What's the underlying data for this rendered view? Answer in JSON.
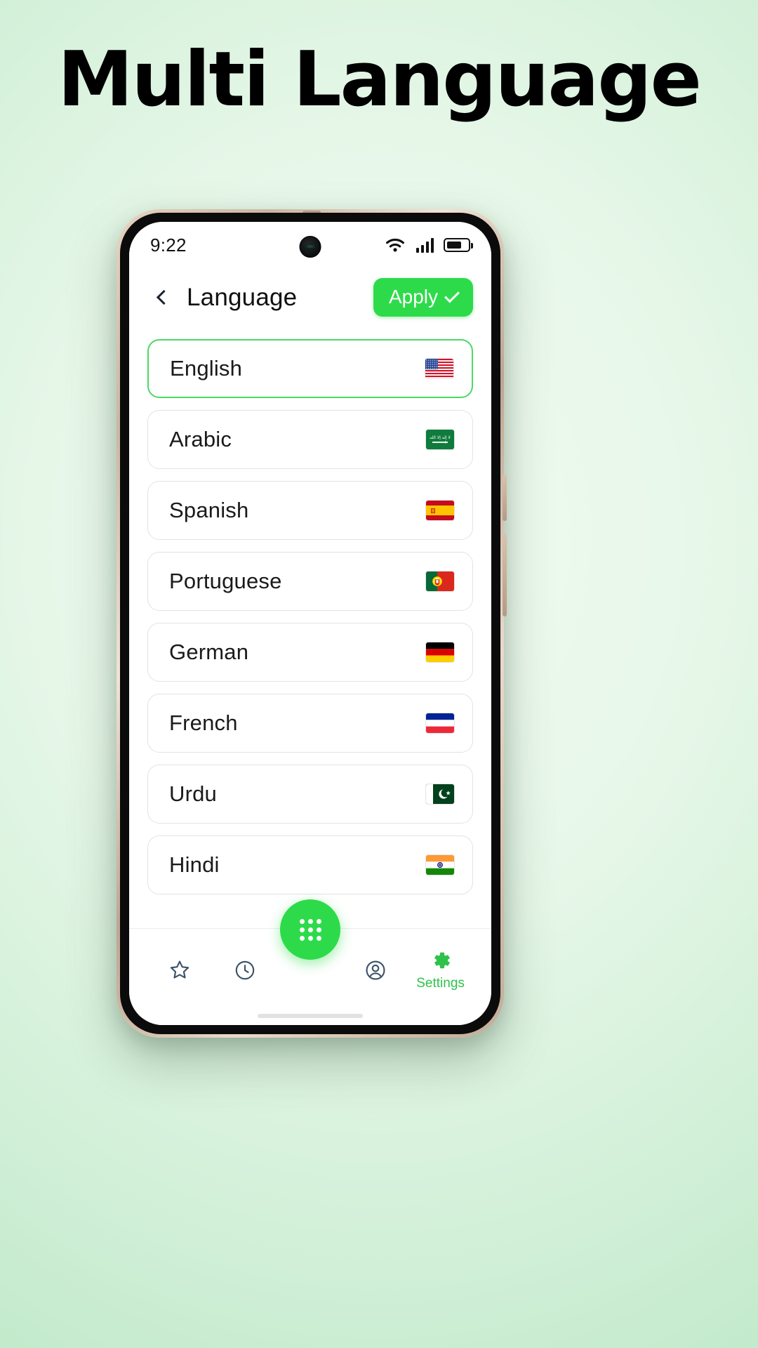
{
  "hero": {
    "title": "Multi Language"
  },
  "theme": {
    "accent": "#2ddb4a",
    "accent_border": "#4cd964",
    "background_start": "#f2fbf3",
    "background_end": "#b8e6c3",
    "text": "#111111"
  },
  "status_bar": {
    "time": "9:22",
    "icons": [
      "wifi-icon",
      "signal-bars-icon",
      "battery-icon"
    ]
  },
  "header": {
    "back_icon": "chevron-left-icon",
    "title": "Language",
    "apply_label": "Apply",
    "apply_icon": "check-icon"
  },
  "languages": [
    {
      "name": "English",
      "flag": "us",
      "selected": true
    },
    {
      "name": "Arabic",
      "flag": "sa",
      "selected": false
    },
    {
      "name": "Spanish",
      "flag": "es",
      "selected": false
    },
    {
      "name": "Portuguese",
      "flag": "pt",
      "selected": false
    },
    {
      "name": "German",
      "flag": "de",
      "selected": false
    },
    {
      "name": "French",
      "flag": "fr",
      "selected": false
    },
    {
      "name": "Urdu",
      "flag": "pk",
      "selected": false
    },
    {
      "name": "Hindi",
      "flag": "in",
      "selected": false
    }
  ],
  "bottom_nav": {
    "items": [
      {
        "icon": "star-icon",
        "label": "",
        "active": false
      },
      {
        "icon": "clock-icon",
        "label": "",
        "active": false
      },
      {
        "icon": "grid-dots-icon",
        "label": "",
        "active": false
      },
      {
        "icon": "person-icon",
        "label": "",
        "active": false
      },
      {
        "icon": "gear-icon",
        "label": "Settings",
        "active": true
      }
    ]
  }
}
